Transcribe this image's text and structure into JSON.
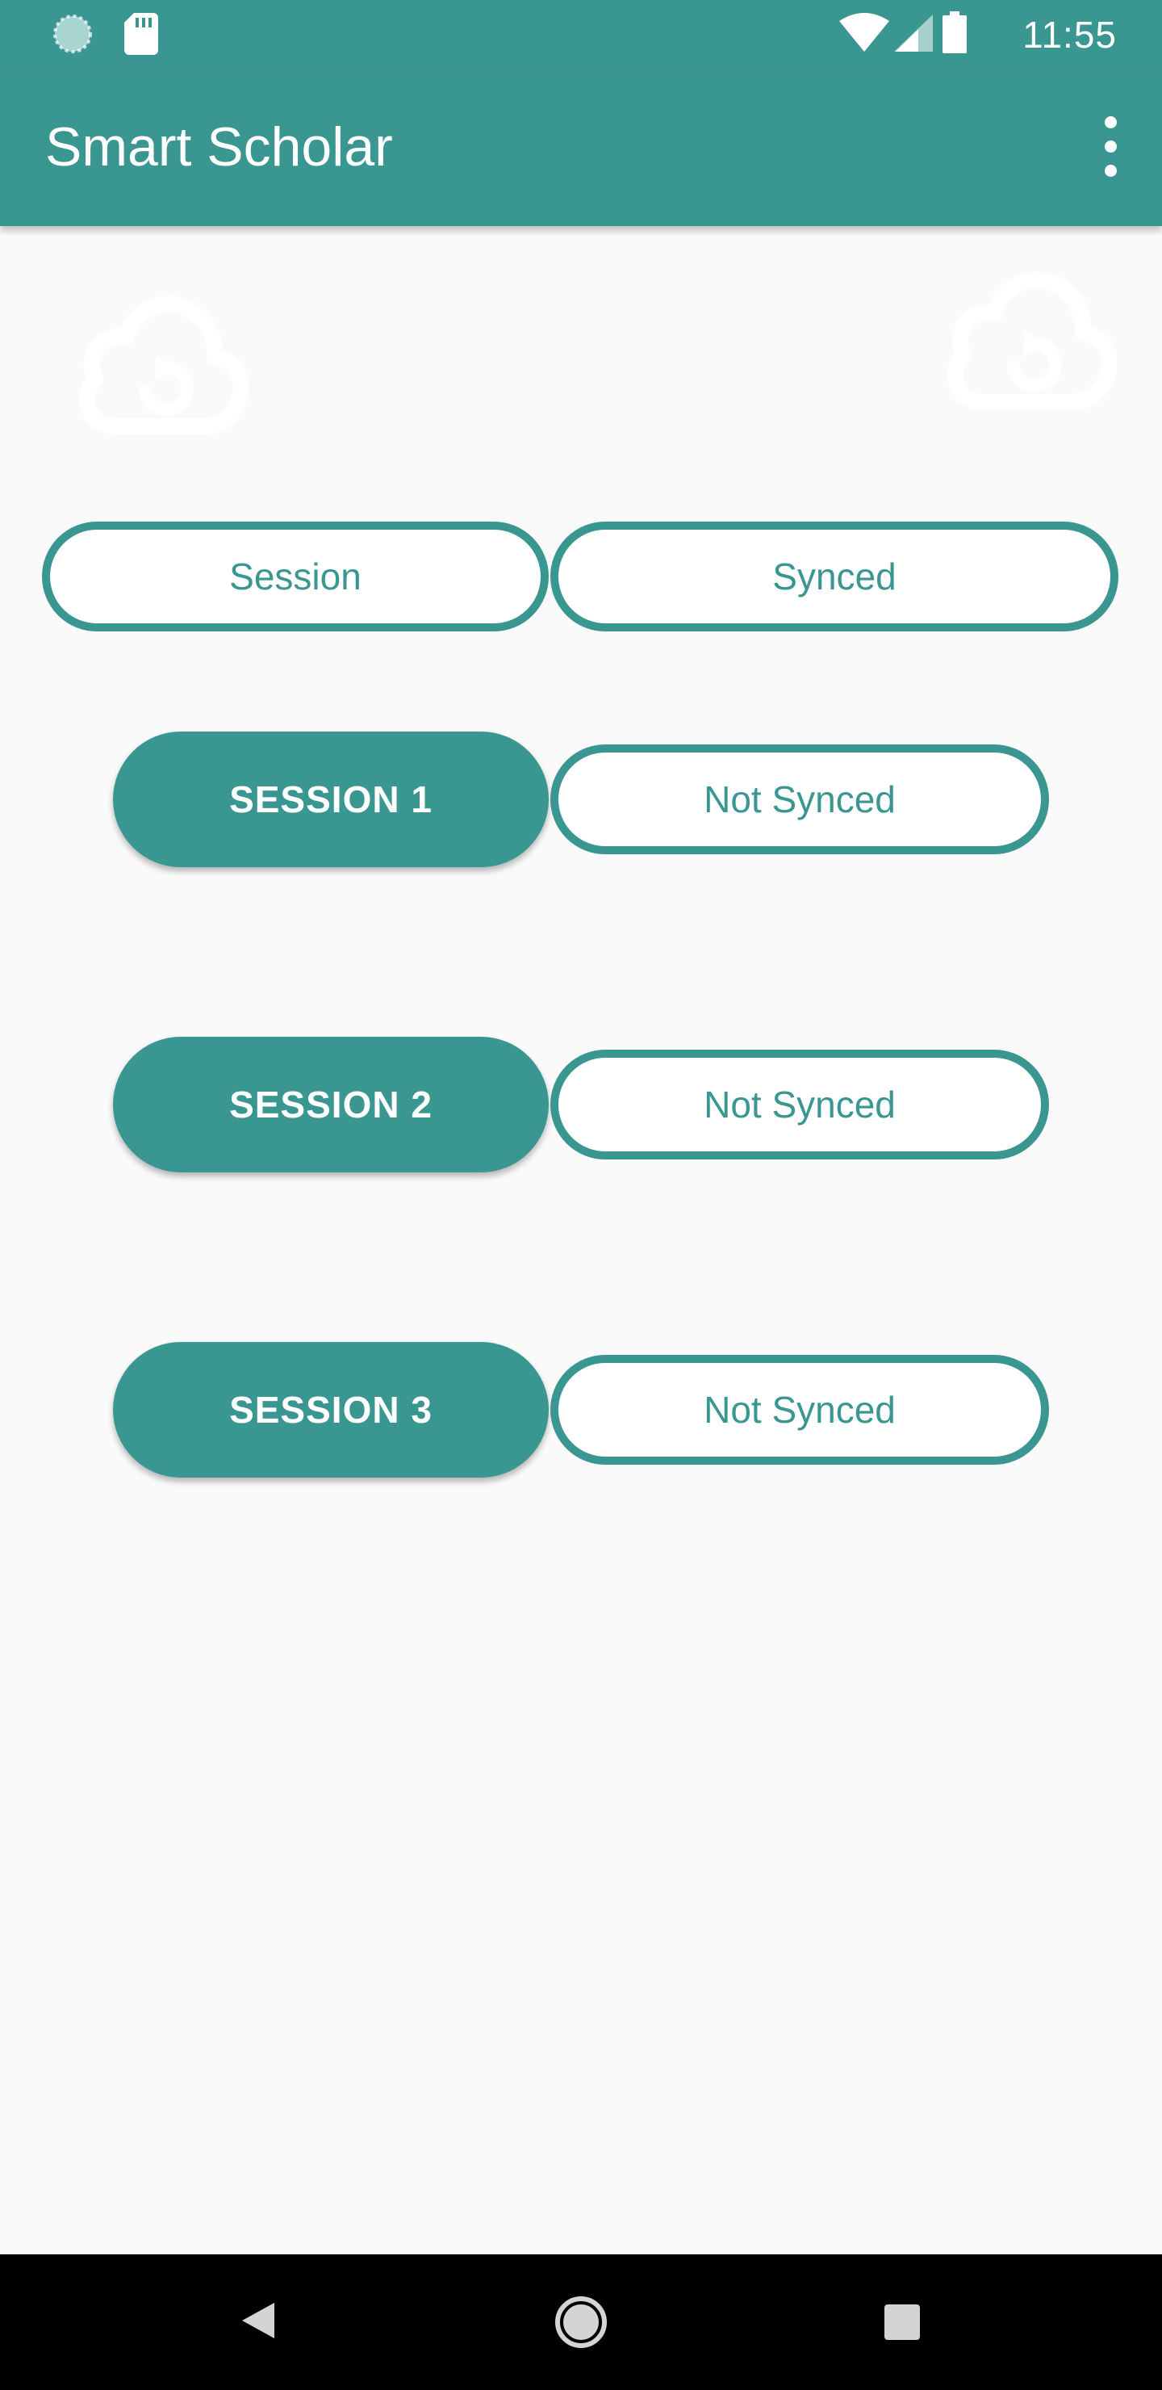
{
  "status_bar": {
    "time": "11:55",
    "icons": [
      "loader-icon",
      "sdcard-icon",
      "wifi-icon",
      "signal-icon",
      "battery-icon"
    ]
  },
  "app_bar": {
    "title": "Smart Scholar",
    "menu_icon": "more-vert-icon"
  },
  "content": {
    "sync_icons": [
      "cloud-sync-icon",
      "cloud-sync-icon"
    ],
    "header": {
      "session_label": "Session",
      "synced_label": "Synced"
    },
    "sessions": [
      {
        "button_label": "SESSION 1",
        "status": "Not Synced"
      },
      {
        "button_label": "SESSION 2",
        "status": "Not Synced"
      },
      {
        "button_label": "SESSION 3",
        "status": "Not Synced"
      }
    ]
  },
  "nav_bar": {
    "icons": [
      "back-icon",
      "home-icon",
      "recents-icon"
    ]
  },
  "colors": {
    "primary": "#3a9691",
    "background": "#fafafa",
    "pill_fill": "#ffffff",
    "nav_bar": "#000000"
  }
}
